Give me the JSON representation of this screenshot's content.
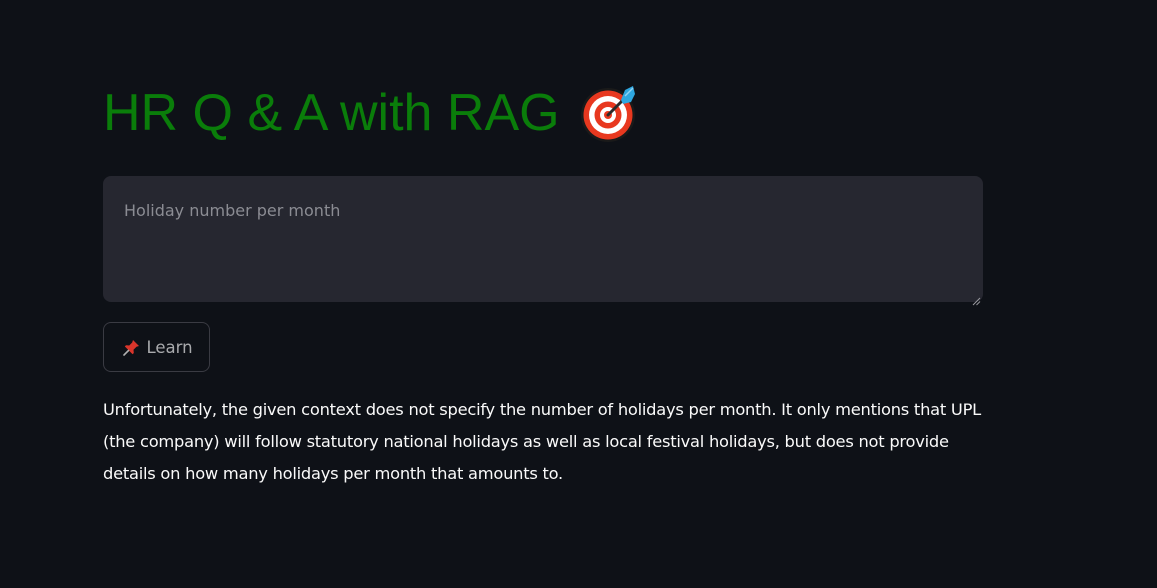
{
  "page": {
    "title": "HR Q & A with RAG",
    "title_icon": "target-dart-icon",
    "title_color": "#0a7d0a",
    "background": "#0e1117"
  },
  "query": {
    "value": "",
    "placeholder": "Holiday number per month"
  },
  "learn_button": {
    "icon": "pushpin-icon",
    "label": "Learn"
  },
  "answer": {
    "text": "Unfortunately, the given context does not specify the number of holidays per month. It only mentions that UPL (the company) will follow statutory national holidays as well as local festival holidays, but does not provide details on how many holidays per month that amounts to."
  }
}
